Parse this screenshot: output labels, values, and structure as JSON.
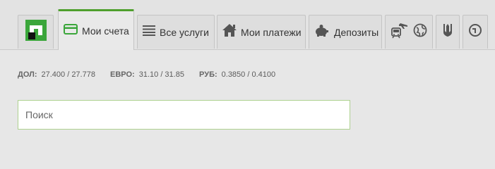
{
  "tabs": {
    "logo": {
      "icon": "privatbank-logo"
    },
    "accounts": {
      "label": "Мои счета",
      "icon": "card-icon"
    },
    "services": {
      "label": "Все услуги",
      "icon": "list-icon"
    },
    "payments": {
      "label": "Мои платежи",
      "icon": "house-icon"
    },
    "deposits": {
      "label": "Депозиты",
      "icon": "piggy-bank-icon"
    },
    "travel": {
      "icons": [
        "transport-icon",
        "globe-icon"
      ]
    },
    "gov": {
      "icon": "trident-icon"
    },
    "more": {
      "icon": "clock-icon"
    },
    "active": "accounts"
  },
  "rates": [
    {
      "code": "ДОЛ:",
      "value": "27.400 / 27.778"
    },
    {
      "code": "ЕВРО:",
      "value": "31.10 / 31.85"
    },
    {
      "code": "РУБ:",
      "value": "0.3850 / 0.4100"
    }
  ],
  "search": {
    "placeholder": "Поиск",
    "value": ""
  },
  "colors": {
    "accent": "#4fa02d",
    "logo_green": "#3aa63a",
    "search_border": "#aed18f"
  }
}
